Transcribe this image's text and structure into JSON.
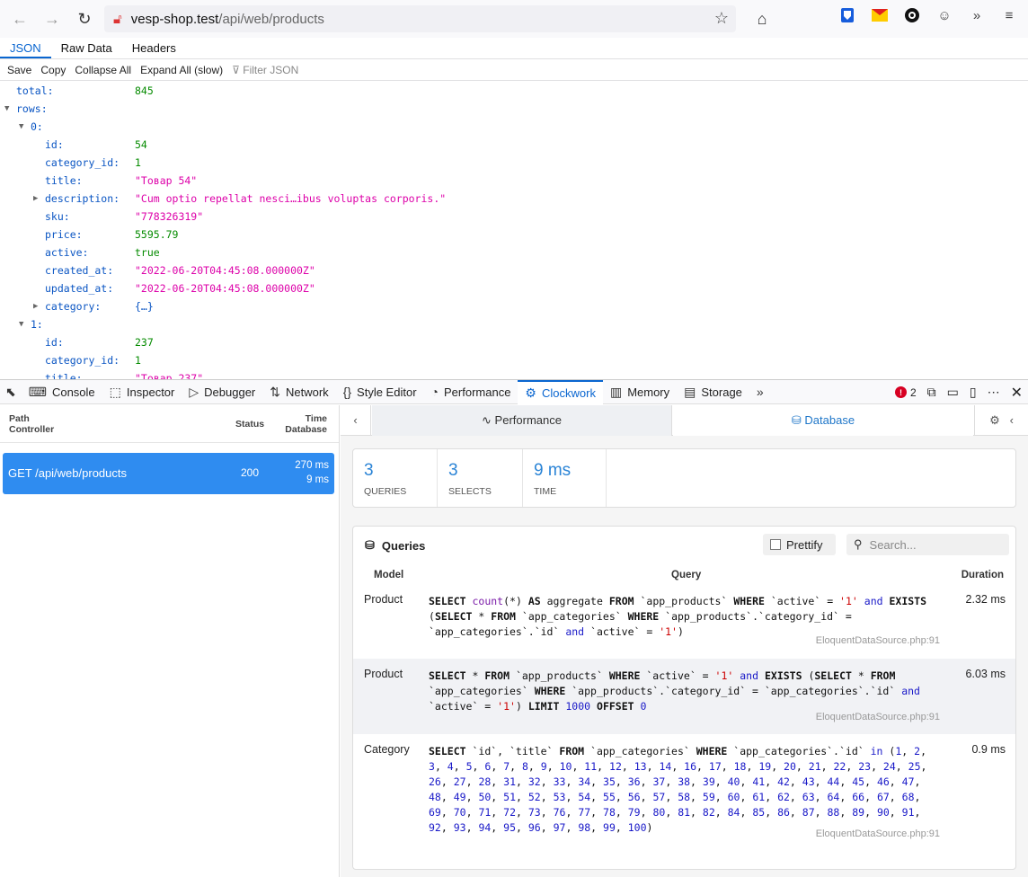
{
  "browser": {
    "url_host": "vesp-shop.test",
    "url_path": "/api/web/products"
  },
  "json_tabs": [
    "JSON",
    "Raw Data",
    "Headers"
  ],
  "json_tools": {
    "save": "Save",
    "copy": "Copy",
    "collapse_all": "Collapse All",
    "expand_all": "Expand All (slow)",
    "filter_placeholder": "Filter JSON"
  },
  "json_tree": [
    {
      "key": "total:",
      "value": "845",
      "type": "num",
      "indent": 0,
      "twisty": ""
    },
    {
      "key": "rows:",
      "value": "",
      "type": "",
      "indent": 0,
      "twisty": "open"
    },
    {
      "key": "0:",
      "value": "",
      "type": "",
      "indent": 1,
      "twisty": "open"
    },
    {
      "key": "id:",
      "value": "54",
      "type": "num",
      "indent": 2,
      "twisty": ""
    },
    {
      "key": "category_id:",
      "value": "1",
      "type": "num",
      "indent": 2,
      "twisty": ""
    },
    {
      "key": "title:",
      "value": "\"Товар 54\"",
      "type": "str",
      "indent": 2,
      "twisty": ""
    },
    {
      "key": "description:",
      "value": "\"Cum optio repellat nesci…ibus voluptas corporis.\"",
      "type": "str",
      "indent": 2,
      "twisty": "closed"
    },
    {
      "key": "sku:",
      "value": "\"778326319\"",
      "type": "str",
      "indent": 2,
      "twisty": ""
    },
    {
      "key": "price:",
      "value": "5595.79",
      "type": "num",
      "indent": 2,
      "twisty": ""
    },
    {
      "key": "active:",
      "value": "true",
      "type": "bool",
      "indent": 2,
      "twisty": ""
    },
    {
      "key": "created_at:",
      "value": "\"2022-06-20T04:45:08.000000Z\"",
      "type": "str",
      "indent": 2,
      "twisty": ""
    },
    {
      "key": "updated_at:",
      "value": "\"2022-06-20T04:45:08.000000Z\"",
      "type": "str",
      "indent": 2,
      "twisty": ""
    },
    {
      "key": "category:",
      "value": "{…}",
      "type": "obj",
      "indent": 2,
      "twisty": "closed"
    },
    {
      "key": "1:",
      "value": "",
      "type": "",
      "indent": 1,
      "twisty": "open"
    },
    {
      "key": "id:",
      "value": "237",
      "type": "num",
      "indent": 2,
      "twisty": ""
    },
    {
      "key": "category_id:",
      "value": "1",
      "type": "num",
      "indent": 2,
      "twisty": ""
    },
    {
      "key": "title:",
      "value": "\"Товар 237\"",
      "type": "str",
      "indent": 2,
      "twisty": ""
    }
  ],
  "devtools": {
    "tabs": [
      {
        "label": "Console",
        "icon": "console-icon",
        "glyph": "⌨"
      },
      {
        "label": "Inspector",
        "icon": "inspector-icon",
        "glyph": "⬚"
      },
      {
        "label": "Debugger",
        "icon": "debugger-icon",
        "glyph": "▷"
      },
      {
        "label": "Network",
        "icon": "network-icon",
        "glyph": "⇅"
      },
      {
        "label": "Style Editor",
        "icon": "style-editor-icon",
        "glyph": "{}"
      },
      {
        "label": "Performance",
        "icon": "performance-icon",
        "glyph": "◔"
      },
      {
        "label": "Clockwork",
        "icon": "clockwork-icon",
        "glyph": "⚙",
        "active": true
      },
      {
        "label": "Memory",
        "icon": "memory-icon",
        "glyph": "▥"
      },
      {
        "label": "Storage",
        "icon": "storage-icon",
        "glyph": "▤"
      }
    ],
    "error_count": "2"
  },
  "requests": {
    "headers": {
      "path": "Path",
      "controller": "Controller",
      "status": "Status",
      "time": "Time",
      "database": "Database"
    },
    "rows": [
      {
        "path": "GET /api/web/products",
        "status": "200",
        "time": "270 ms",
        "db": "9 ms"
      }
    ]
  },
  "panel_tabs": {
    "performance": "Performance",
    "database": "Database"
  },
  "stats": [
    {
      "value": "3",
      "label": "QUERIES"
    },
    {
      "value": "3",
      "label": "SELECTS"
    },
    {
      "value": "9 ms",
      "label": "TIME"
    }
  ],
  "queries": {
    "title": "Queries",
    "prettify": "Prettify",
    "search_placeholder": "Search...",
    "columns": {
      "model": "Model",
      "query": "Query",
      "duration": "Duration"
    },
    "rows": [
      {
        "model": "Product",
        "duration": "2.32 ms",
        "source": "EloquentDataSource.php:91",
        "sql": "SELECT count(*) AS aggregate FROM `app_products` WHERE `active` = '1' and EXISTS (SELECT * FROM `app_categories` WHERE `app_products`.`category_id` = `app_categories`.`id` and `active` = '1')"
      },
      {
        "model": "Product",
        "duration": "6.03 ms",
        "source": "EloquentDataSource.php:91",
        "sql": "SELECT * FROM `app_products` WHERE `active` = '1' and EXISTS (SELECT * FROM `app_categories` WHERE `app_products`.`category_id` = `app_categories`.`id` and `active` = '1') LIMIT 1000 OFFSET 0"
      },
      {
        "model": "Category",
        "duration": "0.9 ms",
        "source": "EloquentDataSource.php:91",
        "sql": "SELECT `id`, `title` FROM `app_categories` WHERE `app_categories`.`id` in (1, 2, 3, 4, 5, 6, 7, 8, 9, 10, 11, 12, 13, 14, 16, 17, 18, 19, 20, 21, 22, 23, 24, 25, 26, 27, 28, 31, 32, 33, 34, 35, 36, 37, 38, 39, 40, 41, 42, 43, 44, 45, 46, 47, 48, 49, 50, 51, 52, 53, 54, 55, 56, 57, 58, 59, 60, 61, 62, 63, 64, 66, 67, 68, 69, 70, 71, 72, 73, 76, 77, 78, 79, 80, 81, 82, 84, 85, 86, 87, 88, 89, 90, 91, 92, 93, 94, 95, 96, 97, 98, 99, 100)"
      }
    ]
  }
}
